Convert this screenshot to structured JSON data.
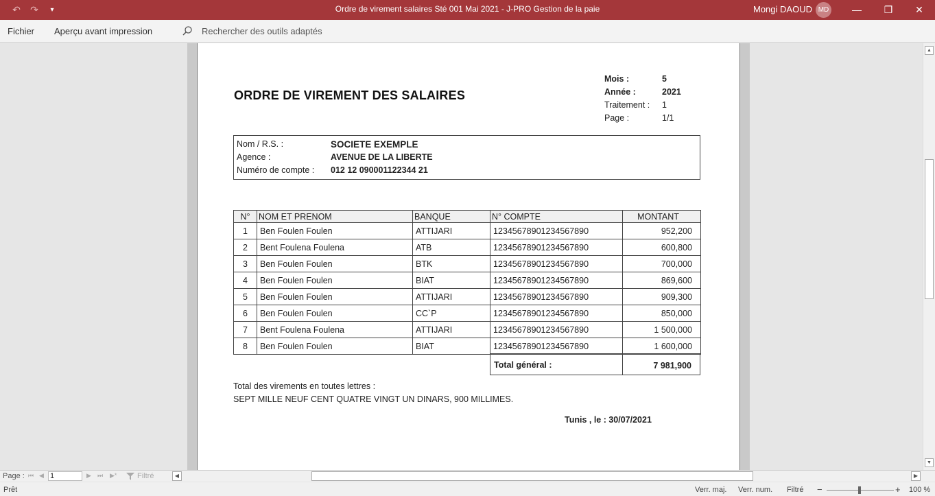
{
  "titlebar": {
    "title": "Ordre de virement salaires Sté 001 Mai 2021  -  J-PRO Gestion de la paie",
    "user": "Mongi DAOUD",
    "avatar": "MD",
    "icons": [
      "undo-icon",
      "redo-icon",
      "customize-qat-icon",
      "minimize-icon",
      "restore-icon",
      "close-icon"
    ]
  },
  "ribbon": {
    "file": "Fichier",
    "print_preview": "Aperçu avant impression",
    "search_placeholder": "Rechercher des outils adaptés"
  },
  "report": {
    "title": "ORDRE DE VIREMENT DES SALAIRES",
    "meta": [
      {
        "label": "Mois :",
        "value": "5"
      },
      {
        "label": "Année :",
        "value": "2021"
      },
      {
        "label": "Traitement :",
        "value": "1"
      },
      {
        "label": "Page :",
        "value": "1/1"
      }
    ],
    "company": {
      "name_label": "Nom / R.S. :",
      "name": "SOCIETE EXEMPLE",
      "agency_label": "Agence :",
      "agency": "AVENUE DE LA LIBERTE",
      "account_label": "Numéro de compte :",
      "account": "012 12 090001122344 21"
    },
    "columns": [
      "N°",
      "NOM ET PRENOM",
      "BANQUE",
      "N° COMPTE",
      "MONTANT"
    ],
    "rows": [
      {
        "n": "1",
        "name": "Ben Foulen Foulen",
        "bank": "ATTIJARI",
        "account": "12345678901234567890",
        "amount": "952,200"
      },
      {
        "n": "2",
        "name": "Bent Foulena Foulena",
        "bank": "ATB",
        "account": "12345678901234567890",
        "amount": "600,800"
      },
      {
        "n": "3",
        "name": "Ben Foulen Foulen",
        "bank": "BTK",
        "account": "12345678901234567890",
        "amount": "700,000"
      },
      {
        "n": "4",
        "name": "Ben Foulen Foulen",
        "bank": "BIAT",
        "account": "12345678901234567890",
        "amount": "869,600"
      },
      {
        "n": "5",
        "name": "Ben Foulen Foulen",
        "bank": "ATTIJARI",
        "account": "12345678901234567890",
        "amount": "909,300"
      },
      {
        "n": "6",
        "name": "Ben Foulen Foulen",
        "bank": "CC`P",
        "account": "12345678901234567890",
        "amount": "850,000"
      },
      {
        "n": "7",
        "name": "Bent Foulena Foulena",
        "bank": "ATTIJARI",
        "account": "12345678901234567890",
        "amount": "1 500,000"
      },
      {
        "n": "8",
        "name": "Ben Foulen Foulen",
        "bank": "BIAT",
        "account": "12345678901234567890",
        "amount": "1 600,000"
      }
    ],
    "total_label": "Total général :",
    "total_value": "7 981,900",
    "letters_label": "Total des virements en toutes lettres :",
    "letters_value": "SEPT MILLE NEUF CENT QUATRE VINGT UN DINARS, 900 MILLIMES.",
    "place_date": "Tunis , le : 30/07/2021"
  },
  "navigation": {
    "page_label": "Page :",
    "page_value": "1",
    "filter_label": "Filtré"
  },
  "statusbar": {
    "ready": "Prêt",
    "caps": "Verr. maj.",
    "num": "Verr. num.",
    "filtered": "Filtré",
    "zoom": "100 %"
  }
}
